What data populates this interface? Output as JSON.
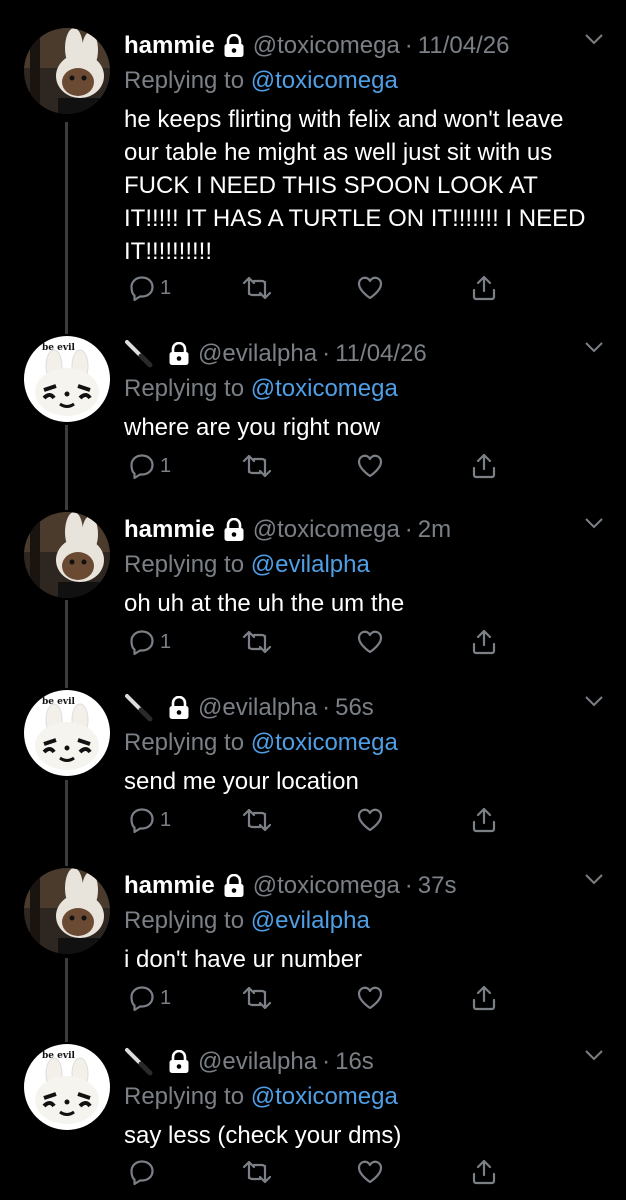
{
  "colors": {
    "background": "#000000",
    "text": "#ffffff",
    "muted": "#7b8086",
    "link": "#4f9fe6",
    "thread_line": "#3a3d40"
  },
  "tweets": [
    {
      "display_name": "hammie",
      "handle": "@toxicomega",
      "separator": "·",
      "time": "11/04/26",
      "replying_prefix": "Replying to",
      "replying_to": "@toxicomega",
      "text": "he keeps flirting with felix and won't leave our table he might as well just sit with us FUCK I NEED THIS SPOON LOOK AT IT!!!!! IT HAS A TURTLE ON IT!!!!!!! I NEED IT!!!!!!!!!!",
      "reply_count": "1",
      "avatar": "plush-doll-avatar"
    },
    {
      "display_name": "",
      "name_icon": "knife-icon",
      "handle": "@evilalpha",
      "separator": "·",
      "time": "11/04/26",
      "replying_prefix": "Replying to",
      "replying_to": "@toxicomega",
      "text": "where are you right now",
      "reply_count": "1",
      "avatar_caption": "be evil"
    },
    {
      "display_name": "hammie",
      "handle": "@toxicomega",
      "separator": "·",
      "time": "2m",
      "replying_prefix": "Replying to",
      "replying_to": "@evilalpha",
      "text": "oh uh at the uh the um the",
      "reply_count": "1",
      "avatar": "plush-doll-avatar"
    },
    {
      "display_name": "",
      "name_icon": "knife-icon",
      "handle": "@evilalpha",
      "separator": "·",
      "time": "56s",
      "replying_prefix": "Replying to",
      "replying_to": "@toxicomega",
      "text": "send me your location",
      "reply_count": "1",
      "avatar_caption": "be evil"
    },
    {
      "display_name": "hammie",
      "handle": "@toxicomega",
      "separator": "·",
      "time": "37s",
      "replying_prefix": "Replying to",
      "replying_to": "@evilalpha",
      "text": "i don't have ur number",
      "reply_count": "1",
      "avatar": "plush-doll-avatar"
    },
    {
      "display_name": "",
      "name_icon": "knife-icon",
      "handle": "@evilalpha",
      "separator": "·",
      "time": "16s",
      "replying_prefix": "Replying to",
      "replying_to": "@toxicomega",
      "text": "say less (check your dms)",
      "reply_count": "",
      "avatar_caption": "be evil"
    }
  ]
}
